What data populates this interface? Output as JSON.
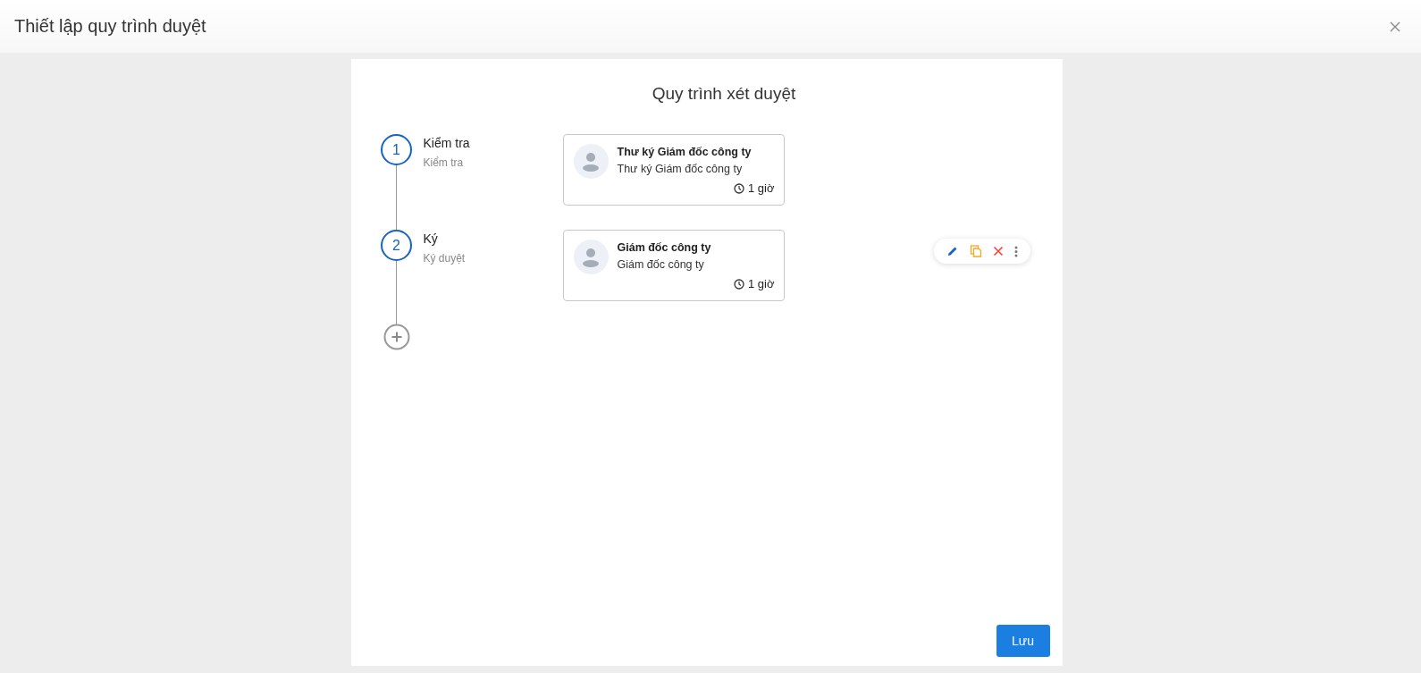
{
  "dialog": {
    "title": "Thiết lập quy trình duyệt"
  },
  "panel": {
    "title": "Quy trình xét duyệt"
  },
  "steps": [
    {
      "number": "1",
      "name": "Kiểm tra",
      "description": "Kiểm tra",
      "approver": {
        "title": "Thư ký Giám đốc công ty",
        "subtitle": "Thư ký Giám đốc công ty",
        "duration": "1 giờ"
      },
      "hovered": false
    },
    {
      "number": "2",
      "name": "Ký",
      "description": "Ký duyệt",
      "approver": {
        "title": "Giám đốc công ty",
        "subtitle": "Giám đốc công ty",
        "duration": "1 giờ"
      },
      "hovered": true
    }
  ],
  "save_button": "Lưu"
}
